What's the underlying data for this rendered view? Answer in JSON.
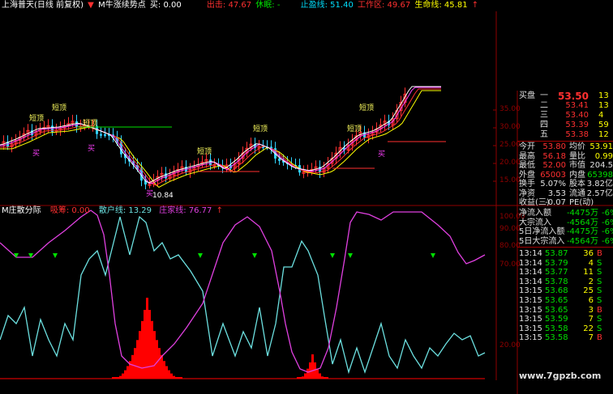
{
  "top_header": {
    "title": "上海普天(日线 前复权)",
    "indicator_name": "M牛涨续势点",
    "buy_label": "买: 0.00",
    "sell_label": "出击: 47.67",
    "defend_label": "休眠: -",
    "stop_label": "止盈线: 51.40",
    "work_label": "工作区: 49.67",
    "life_label": "生命线: 45.81"
  },
  "bottom_header": {
    "title": "M庄散分际",
    "hint_label": "吸筹: 0.00",
    "retail_label": "散户线: 13.29",
    "banker_label": "庄家线: 76.77"
  },
  "annotations": {
    "short_top": "短顶",
    "buy": "买",
    "low_price": "10.84"
  },
  "price_axis": [
    "35.00",
    "30.00",
    "25.00",
    "20.00",
    "15.00"
  ],
  "osc_axis": [
    "100.00",
    "90.00",
    "80.00",
    "70.00",
    "20.00"
  ],
  "colors": {
    "up": "#ff3030",
    "down": "#30d0ff",
    "ma1": "#ffffff",
    "ma2": "#ffff00",
    "ma3": "#ff40ff",
    "retail": "#6ce0e0",
    "banker": "#e040e0",
    "hist": "#ff0000",
    "green_mark": "#00e000",
    "grid": "#900000"
  },
  "quote": {
    "buy_label": "买盘",
    "buy_levels": [
      {
        "label": "一",
        "price": "53.50",
        "vol": "13"
      },
      {
        "label": "二",
        "price": "53.41",
        "vol": "13"
      },
      {
        "label": "三",
        "price": "53.40",
        "vol": "4"
      },
      {
        "label": "四",
        "price": "53.39",
        "vol": "59"
      },
      {
        "label": "五",
        "price": "53.38",
        "vol": "12"
      }
    ],
    "stats": [
      {
        "l1": "今开",
        "v1": "53.80",
        "l2": "均价",
        "v2": "53.91"
      },
      {
        "l1": "最高",
        "v1": "56.18",
        "l2": "量比",
        "v2": "0.99"
      },
      {
        "l1": "最低",
        "v1": "52.00",
        "l2": "市值",
        "v2": "204.5"
      },
      {
        "l1": "外盘",
        "v1": "65003",
        "l2": "内盘",
        "v2": "65398"
      },
      {
        "l1": "换手",
        "v1": "5.07%",
        "l2": "股本",
        "v2": "3.82亿"
      },
      {
        "l1": "净资",
        "v1": "3.53",
        "l2": "流通",
        "v2": "2.57亿"
      },
      {
        "l1": "收益(三)",
        "v1": "-0.07",
        "l2": "PE(动)",
        "v2": ""
      }
    ],
    "flows": [
      {
        "label": "净流入额",
        "value": "-4475万",
        "pct": "-6%"
      },
      {
        "label": "大宗流入",
        "value": "-4564万",
        "pct": "-6%"
      },
      {
        "label": "5日净流入额",
        "value": "-4475万",
        "pct": "-6%"
      },
      {
        "label": "5日大宗流入",
        "value": "-4564万",
        "pct": "-6%"
      }
    ],
    "ticks": [
      {
        "time": "13:14",
        "price": "53.87",
        "vol": "36",
        "side": "B"
      },
      {
        "time": "13:14",
        "price": "53.79",
        "vol": "4",
        "side": "S"
      },
      {
        "time": "13:14",
        "price": "53.77",
        "vol": "11",
        "side": "S"
      },
      {
        "time": "13:14",
        "price": "53.78",
        "vol": "2",
        "side": "S"
      },
      {
        "time": "13:15",
        "price": "53.68",
        "vol": "25",
        "side": "S"
      },
      {
        "time": "13:15",
        "price": "53.65",
        "vol": "6",
        "side": "S"
      },
      {
        "time": "13:15",
        "price": "53.65",
        "vol": "3",
        "side": "B"
      },
      {
        "time": "13:15",
        "price": "53.59",
        "vol": "7",
        "side": "S"
      },
      {
        "time": "13:15",
        "price": "53.58",
        "vol": "22",
        "side": "S"
      },
      {
        "time": "13:15",
        "price": "53.58",
        "vol": "7",
        "side": "B"
      }
    ]
  },
  "watermark": "www.7gpzb.com"
}
